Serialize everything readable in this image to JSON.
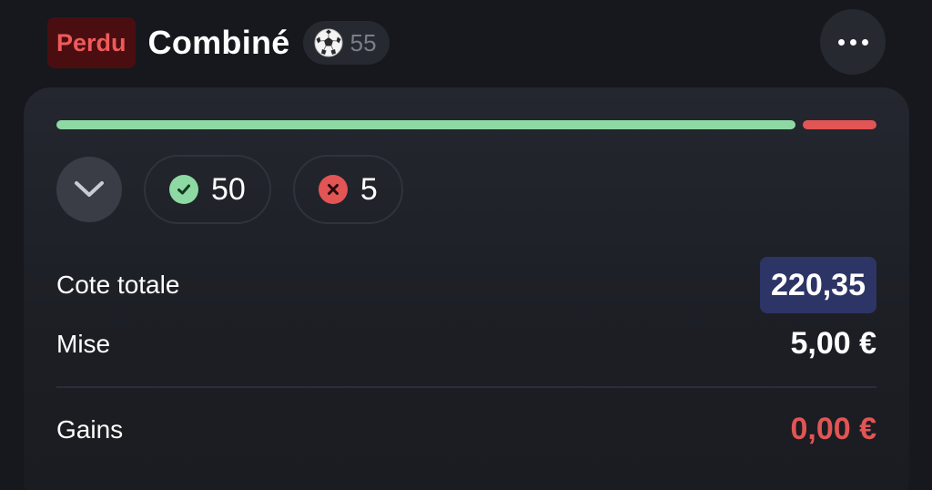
{
  "header": {
    "status": "Perdu",
    "title": "Combiné",
    "sport_icon": "soccer-ball-icon",
    "selection_count": "55",
    "more_icon": "more-horizontal-icon"
  },
  "progress": {
    "won_fraction": 0.909,
    "lost_fraction": 0.091,
    "won_color": "#8ed9a3",
    "lost_color": "#e25555"
  },
  "summary": {
    "expand_icon": "chevron-down-icon",
    "won_icon": "check-circle-icon",
    "won_count": "50",
    "lost_icon": "x-circle-icon",
    "lost_count": "5"
  },
  "details": {
    "odds_label": "Cote totale",
    "odds_value": "220,35",
    "stake_label": "Mise",
    "stake_value": "5,00 €",
    "winnings_label": "Gains",
    "winnings_value": "0,00 €"
  },
  "colors": {
    "background": "#16181d",
    "loss_red": "#e25555",
    "badge_bg": "#4a0e10",
    "odds_badge_bg": "#2d3566"
  }
}
